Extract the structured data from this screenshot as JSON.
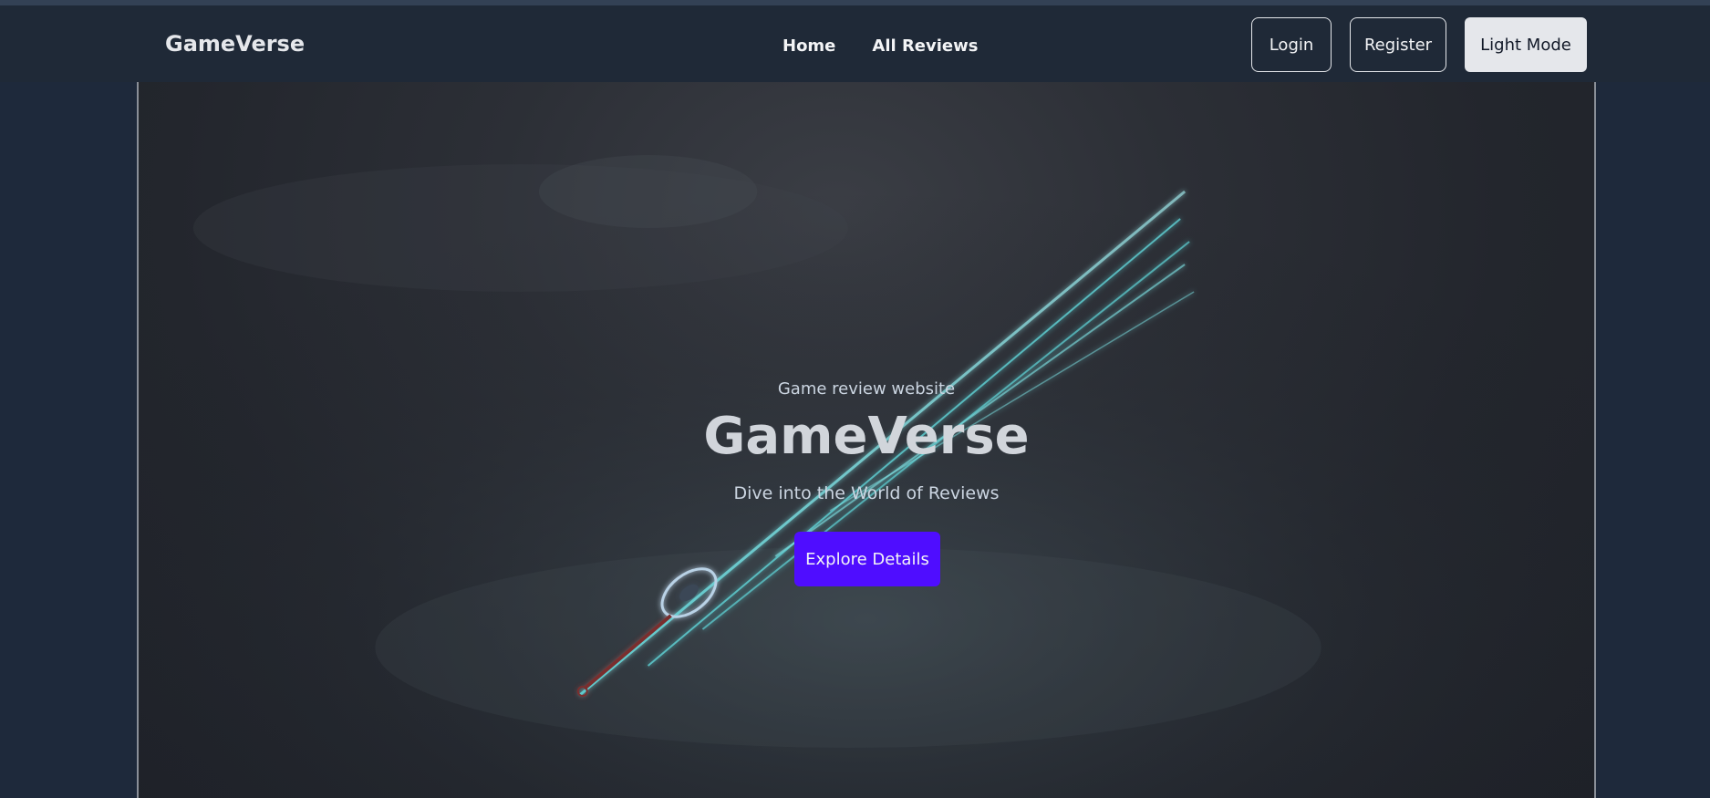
{
  "nav": {
    "brand": "GameVerse",
    "links": [
      "Home",
      "All Reviews"
    ],
    "login": "Login",
    "register": "Register",
    "theme_toggle": "Light Mode"
  },
  "hero": {
    "subtitle": "Game review website",
    "title": "GameVerse",
    "tagline": "Dive into the World of Reviews",
    "cta": "Explore Details"
  },
  "colors": {
    "page_bg": "#1e293b",
    "navbar_bg": "#1f2937",
    "cta_bg": "#4f0dff",
    "light_mode_bg": "#e5e7eb",
    "sword_glow": "#5fd3d6"
  }
}
